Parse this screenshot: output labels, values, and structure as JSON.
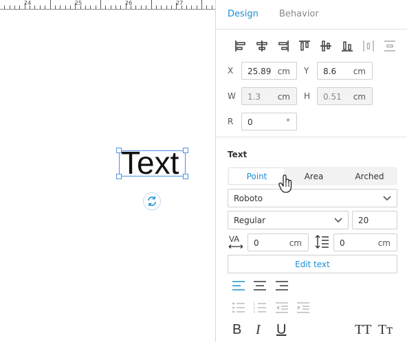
{
  "ruler": {
    "labels": [
      "24",
      "25",
      "26",
      "27"
    ]
  },
  "canvas": {
    "text_object": "Text"
  },
  "tabs": {
    "design": "Design",
    "behavior": "Behavior"
  },
  "position": {
    "x_label": "X",
    "x_value": "25.89",
    "x_unit": "cm",
    "y_label": "Y",
    "y_value": "8.6",
    "y_unit": "cm",
    "w_label": "W",
    "w_value": "1.3",
    "w_unit": "cm",
    "h_label": "H",
    "h_value": "0.51",
    "h_unit": "cm",
    "r_label": "R",
    "r_value": "0",
    "r_unit": "°"
  },
  "text_section": {
    "heading": "Text",
    "modes": [
      "Point",
      "Area",
      "Arched"
    ],
    "font_family": "Roboto",
    "font_weight": "Regular",
    "font_size": "20",
    "letter_spacing": "0",
    "letter_spacing_unit": "cm",
    "line_spacing": "0",
    "line_spacing_unit": "cm",
    "edit_text": "Edit text",
    "bold": "B",
    "italic": "I",
    "underline": "U",
    "uppercase": "TT",
    "titlecase": "Tт"
  },
  "colors": {
    "accent": "#1a8fd6",
    "selection": "#4a90e2"
  }
}
